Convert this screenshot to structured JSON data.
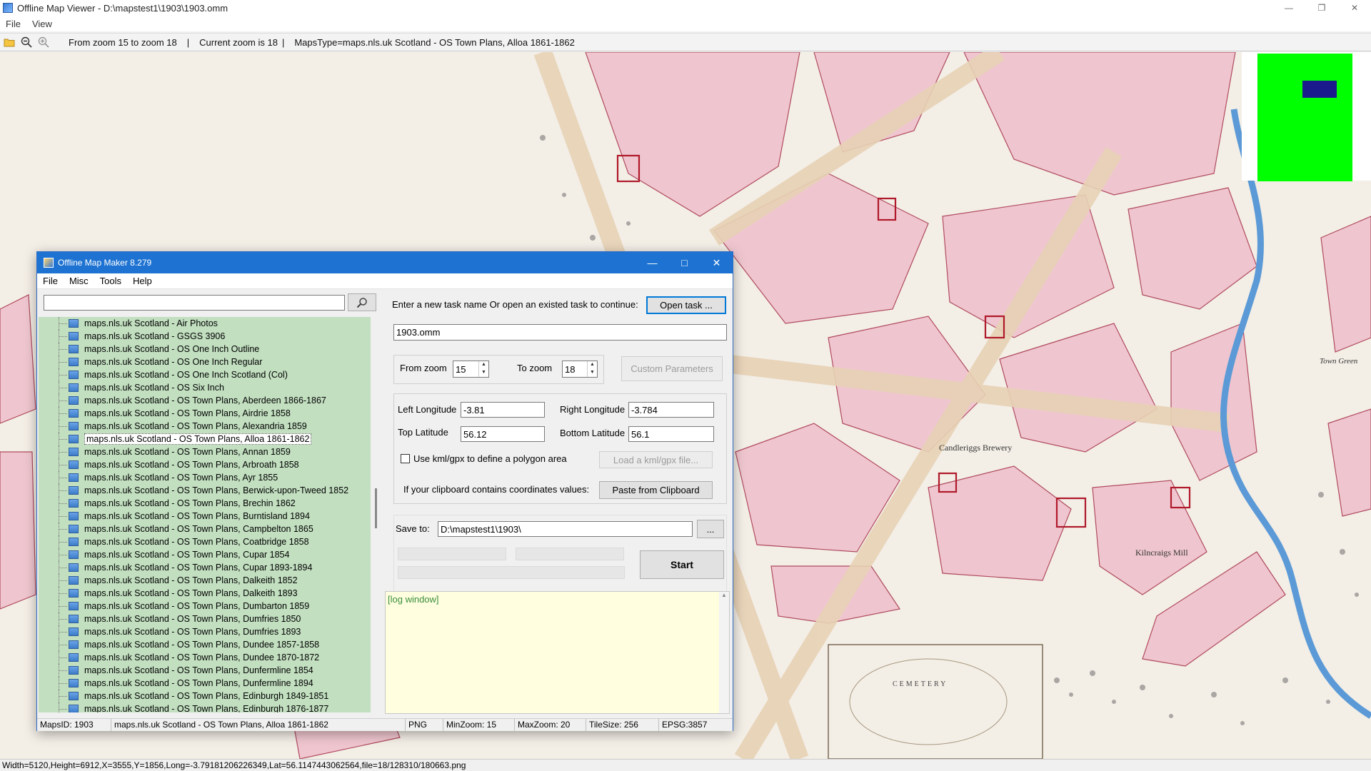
{
  "viewer": {
    "title": "Offline Map Viewer - D:\\mapstest1\\1903\\1903.omm",
    "menu": [
      "File",
      "View"
    ],
    "toolbar": {
      "zoom_range": "From zoom 15 to zoom 18",
      "current_zoom": "Current zoom is 18",
      "maps_type": "MapsType=maps.nls.uk Scotland - OS Town Plans, Alloa 1861-1862"
    },
    "status": "Width=5120,Height=6912,X=3555,Y=1856,Long=-3.79181206226349,Lat=56.1147443062564,file=18/128310/180663.png",
    "map_labels": {
      "cemetery": "CEMETERY",
      "brewery": "Candleriggs Brewery",
      "mill": "Kilncraigs Mill",
      "town_green": "Town Green"
    }
  },
  "maker": {
    "title": "Offline Map Maker 8.279",
    "menu": [
      "File",
      "Misc",
      "Tools",
      "Help"
    ],
    "search": {
      "value": ""
    },
    "tree": {
      "selected_index": 9,
      "items": [
        "maps.nls.uk Scotland - Air Photos",
        "maps.nls.uk Scotland - GSGS 3906",
        "maps.nls.uk Scotland - OS One Inch Outline",
        "maps.nls.uk Scotland - OS One Inch Regular",
        "maps.nls.uk Scotland - OS One Inch Scotland (Col)",
        "maps.nls.uk Scotland - OS Six Inch",
        "maps.nls.uk Scotland - OS Town Plans, Aberdeen 1866-1867",
        "maps.nls.uk Scotland - OS Town Plans, Airdrie 1858",
        "maps.nls.uk Scotland - OS Town Plans, Alexandria 1859",
        "maps.nls.uk Scotland - OS Town Plans, Alloa 1861-1862",
        "maps.nls.uk Scotland - OS Town Plans, Annan 1859",
        "maps.nls.uk Scotland - OS Town Plans, Arbroath 1858",
        "maps.nls.uk Scotland - OS Town Plans, Ayr 1855",
        "maps.nls.uk Scotland - OS Town Plans, Berwick-upon-Tweed 1852",
        "maps.nls.uk Scotland - OS Town Plans, Brechin 1862",
        "maps.nls.uk Scotland - OS Town Plans, Burntisland 1894",
        "maps.nls.uk Scotland - OS Town Plans, Campbelton 1865",
        "maps.nls.uk Scotland - OS Town Plans, Coatbridge 1858",
        "maps.nls.uk Scotland - OS Town Plans, Cupar 1854",
        "maps.nls.uk Scotland - OS Town Plans, Cupar 1893-1894",
        "maps.nls.uk Scotland - OS Town Plans, Dalkeith 1852",
        "maps.nls.uk Scotland - OS Town Plans, Dalkeith 1893",
        "maps.nls.uk Scotland - OS Town Plans, Dumbarton 1859",
        "maps.nls.uk Scotland - OS Town Plans, Dumfries 1850",
        "maps.nls.uk Scotland - OS Town Plans, Dumfries 1893",
        "maps.nls.uk Scotland - OS Town Plans, Dundee 1857-1858",
        "maps.nls.uk Scotland - OS Town Plans, Dundee 1870-1872",
        "maps.nls.uk Scotland - OS Town Plans, Dunfermline 1854",
        "maps.nls.uk Scotland - OS Town Plans, Dunfermline 1894",
        "maps.nls.uk Scotland - OS Town Plans, Edinburgh 1849-1851",
        "maps.nls.uk Scotland - OS Town Plans, Edinburgh 1876-1877"
      ]
    },
    "task_prompt": "Enter a new task name Or open an existed task to continue:",
    "open_task_label": "Open task ...",
    "task_name": "1903.omm",
    "from_zoom_label": "From zoom",
    "from_zoom_value": "15",
    "to_zoom_label": "To zoom",
    "to_zoom_value": "18",
    "custom_params_label": "Custom Parameters",
    "left_lon_label": "Left Longitude",
    "left_lon_value": "-3.81",
    "right_lon_label": "Right Longitude",
    "right_lon_value": "-3.784",
    "top_lat_label": "Top Latitude",
    "top_lat_value": "56.12",
    "bottom_lat_label": "Bottom Latitude",
    "bottom_lat_value": "56.1",
    "kml_checkbox_label": "Use kml/gpx to define a polygon area",
    "kml_checked": false,
    "load_kml_label": "Load a kml/gpx file...",
    "clipboard_prompt": "If your clipboard contains coordinates values:",
    "paste_label": "Paste from Clipboard",
    "save_to_label": "Save to:",
    "save_to_value": "D:\\mapstest1\\1903\\",
    "browse_label": "...",
    "start_label": "Start",
    "log_text": "[log window]",
    "status": {
      "maps_id": "MapsID: 1903",
      "map_name": "maps.nls.uk Scotland - OS Town Plans, Alloa 1861-1862",
      "format": "PNG",
      "min_zoom": "MinZoom: 15",
      "max_zoom": "MaxZoom: 20",
      "tile_size": "TileSize: 256",
      "epsg": "EPSG:3857"
    }
  },
  "colors": {
    "map_paper": "#f3eee6",
    "building_pink": "#efc6cf",
    "building_edge": "#b04a5e",
    "river": "#5b9ad6",
    "tree_panel": "#c2dfc0",
    "titlebar_blue": "#1e73d2",
    "minimap_green": "#00ff00",
    "minimap_box": "#1a1a8c"
  }
}
